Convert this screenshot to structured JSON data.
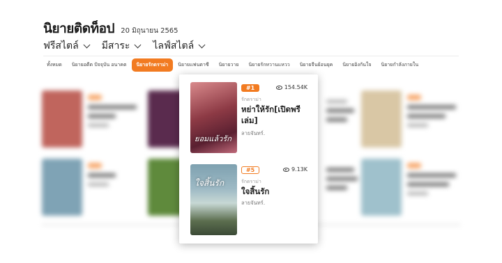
{
  "header": {
    "title": "นิยายติดท็อป",
    "date": "20 มิถุนายน 2565"
  },
  "filters": [
    {
      "label": "ฟรีสไตล์"
    },
    {
      "label": "มีสาระ"
    },
    {
      "label": "ไลฟ์สไตล์"
    }
  ],
  "tabs": [
    {
      "label": "ทั้งหมด",
      "active": false
    },
    {
      "label": "นิยายอดีต ปัจจุบัน อนาคต",
      "active": false
    },
    {
      "label": "นิยายรักดราม่า",
      "active": true
    },
    {
      "label": "นิยายแฟนตาซี",
      "active": false
    },
    {
      "label": "นิยายวาย",
      "active": false
    },
    {
      "label": "นิยายรักหวานแหวว",
      "active": false
    },
    {
      "label": "นิยายจีนย้อนยุค",
      "active": false
    },
    {
      "label": "นิยายอิงกันใจ",
      "active": false
    },
    {
      "label": "นิยายกำลังภายใน",
      "active": false
    }
  ],
  "popup": {
    "books": [
      {
        "rank": "#1",
        "views": "154.54K",
        "genre": "รักดราม่า",
        "title": "หย่าให้รัก[เปิดพรีเล่ม]",
        "author": "ลายจันทร์.",
        "cover_text": "ยอมแล้วรัก",
        "rank_style": "fill"
      },
      {
        "rank": "#5",
        "views": "9.13K",
        "genre": "รักดราม่า",
        "title": "ใจสิ้นรัก",
        "author": "ลายจันทร์.",
        "cover_text": "ใจสิ้นรัก",
        "rank_style": "outline"
      }
    ]
  },
  "colors": {
    "accent": "#f27b21",
    "text": "#222222",
    "muted": "#9a9a9a"
  }
}
